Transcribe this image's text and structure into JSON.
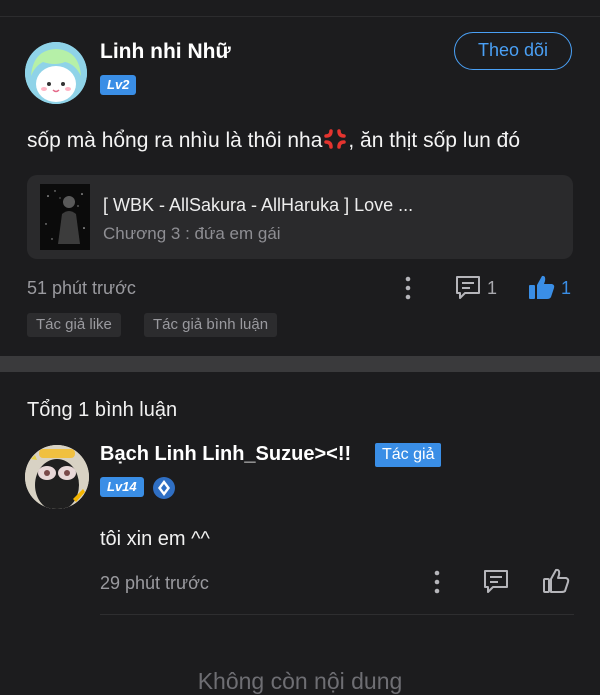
{
  "post": {
    "author_name": "Linh nhi Nhữ",
    "level": "Lv2",
    "follow_label": "Theo dõi",
    "text_before_emoji": "sốp mà hổng ra nhìu là thôi nha",
    "emoji_icon": "anger-symbol-icon",
    "text_after_emoji": ", ăn thịt sốp lun đó",
    "story": {
      "title": "[ WBK - AllSakura - AllHaruka ] Love ...",
      "chapter": "Chương 3 : đứa em gái"
    },
    "time": "51 phút trước",
    "comment_count": "1",
    "like_count": "1",
    "tags": [
      "Tác giả like",
      "Tác giả bình luận"
    ]
  },
  "comments_section": {
    "title": "Tổng 1 bình luận"
  },
  "comment": {
    "author_name": "Bạch Linh Linh_Suzue><!!",
    "author_badge": "Tác giả",
    "level": "Lv14",
    "text": "tôi xin em ^^",
    "time": "29 phút trước"
  },
  "footer": {
    "no_more": "Không còn nội dung"
  },
  "colors": {
    "background": "#1c1c1e",
    "accent": "#3a8ee6",
    "follow_accent": "#4aa0f5"
  }
}
